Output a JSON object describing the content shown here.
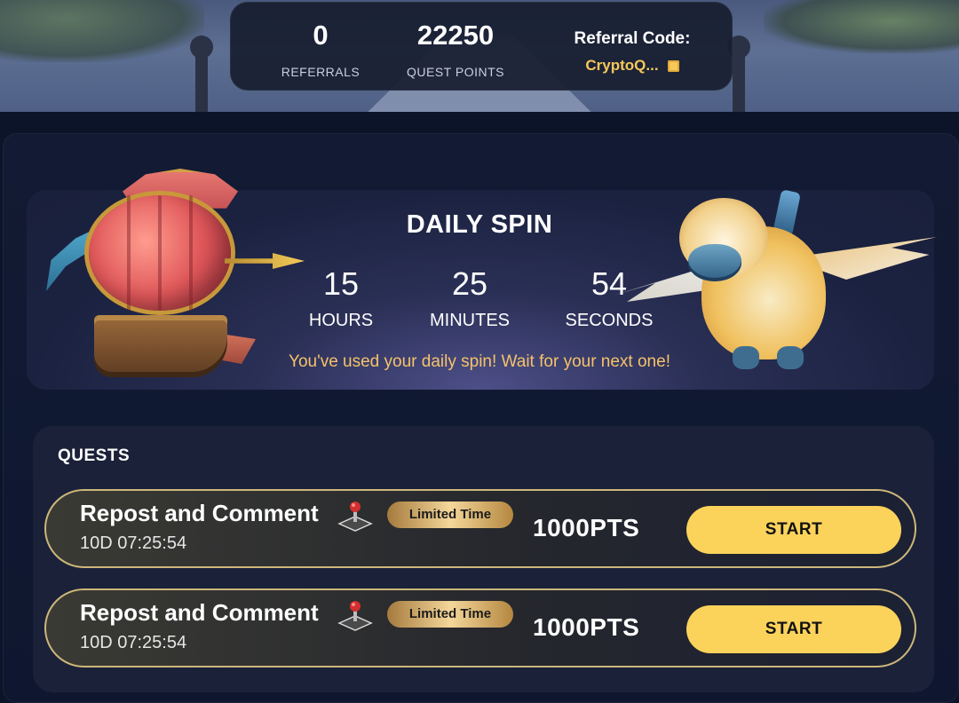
{
  "stats": {
    "referrals_value": "0",
    "referrals_label": "REFERRALS",
    "points_value": "22250",
    "points_label": "QUEST POINTS",
    "referral_code_title": "Referral Code:",
    "referral_code_value": "CryptoQ...",
    "copy_icon": "copy-icon"
  },
  "daily_spin": {
    "title": "DAILY SPIN",
    "hours_value": "15",
    "hours_label": "HOURS",
    "minutes_value": "25",
    "minutes_label": "MINUTES",
    "seconds_value": "54",
    "seconds_label": "SECONDS",
    "message": "You've used your daily spin! Wait for your next one!"
  },
  "quests": {
    "title": "QUESTS",
    "items": [
      {
        "name": "Repost and Comment",
        "timer": "10D 07:25:54",
        "badge": "Limited Time",
        "points": "1000PTS",
        "button": "START",
        "icon": "joystick-icon"
      },
      {
        "name": "Repost and Comment",
        "timer": "10D 07:25:54",
        "badge": "Limited Time",
        "points": "1000PTS",
        "button": "START",
        "icon": "joystick-icon"
      }
    ]
  },
  "colors": {
    "accent_yellow": "#fbd35b",
    "referral_gold": "#f6c85a",
    "message_orange": "#f6c26a",
    "row_border": "#cdb77a",
    "background": "#0b1428"
  }
}
